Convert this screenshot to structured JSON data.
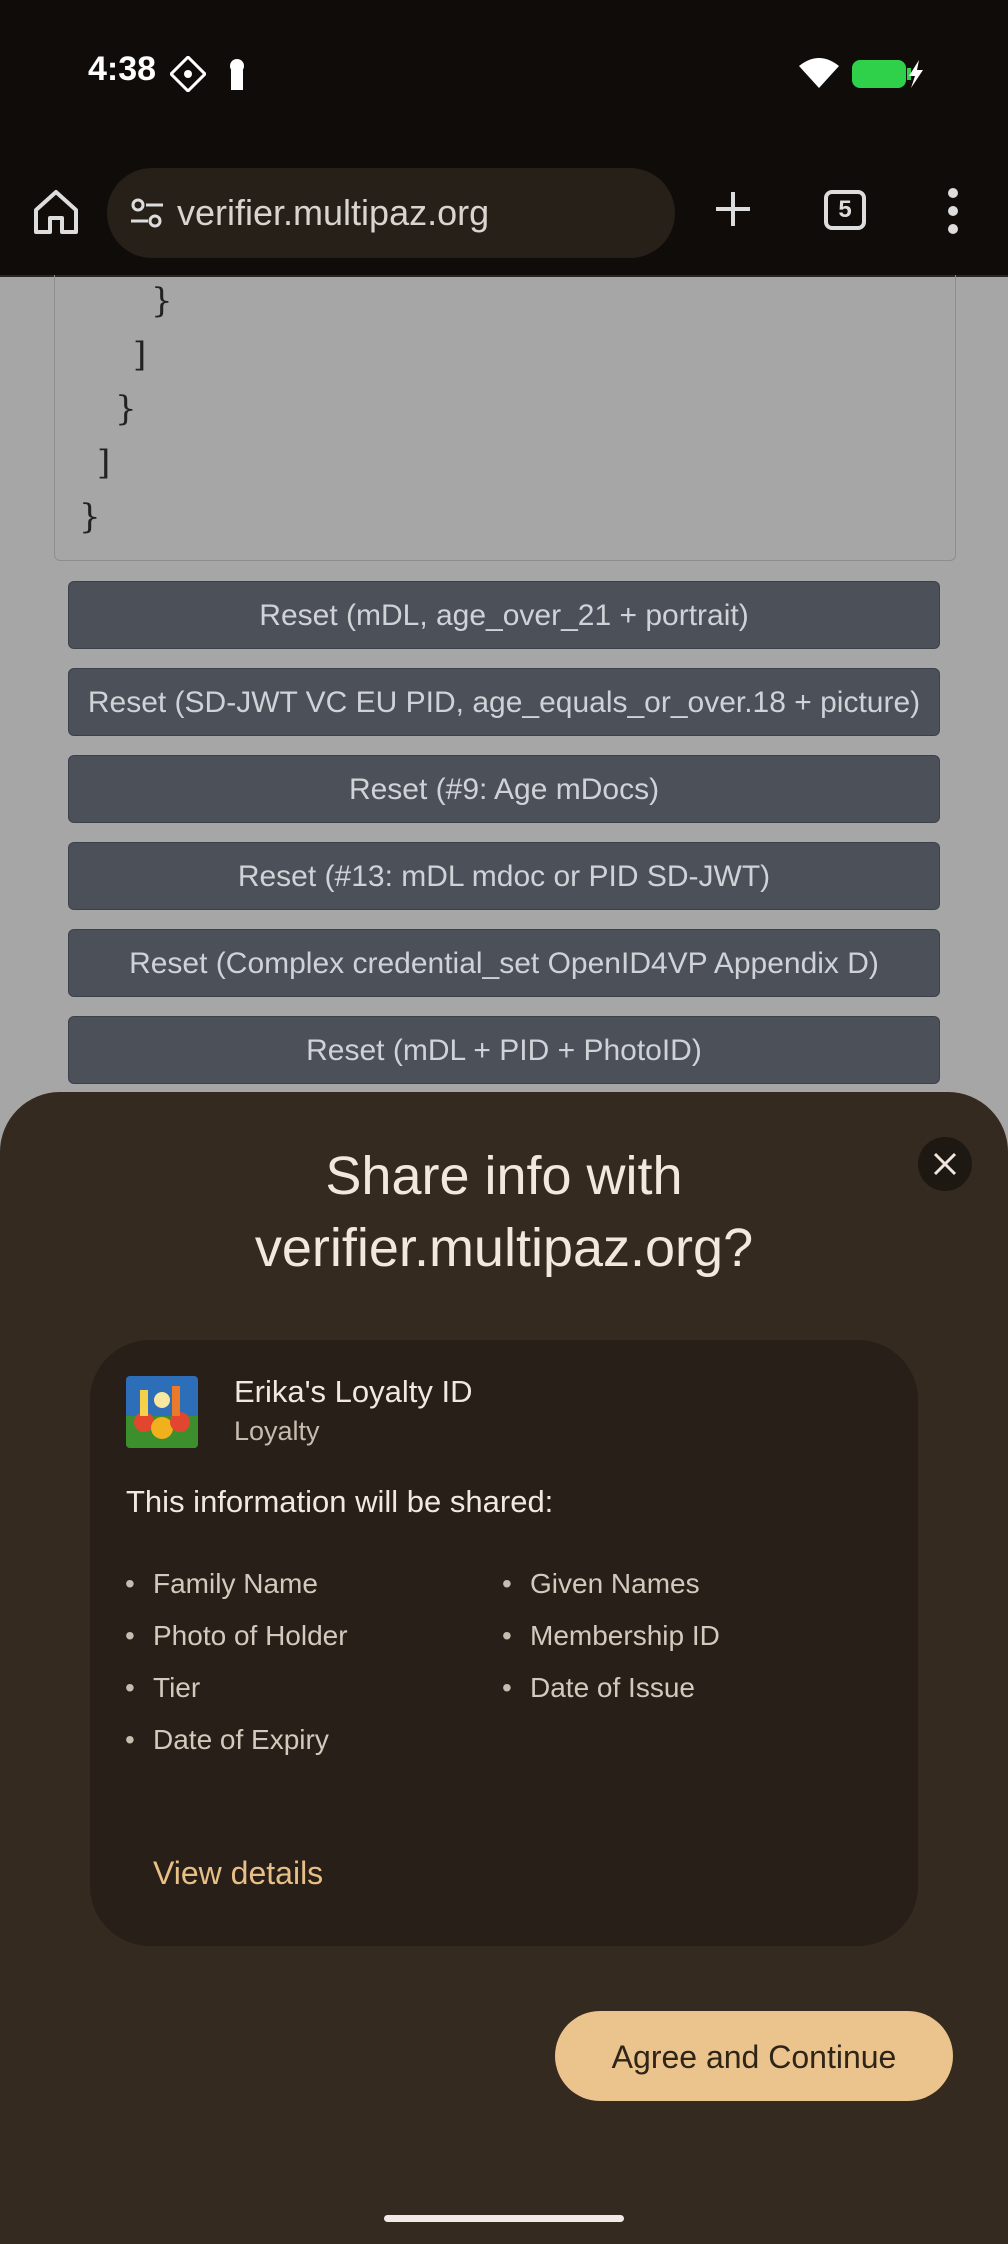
{
  "status_bar": {
    "time": "4:38"
  },
  "browser": {
    "url": "verifier.multipaz.org",
    "tab_count": "5"
  },
  "json_code": {
    "lines": [
      "}",
      "]",
      "}",
      "]",
      "}"
    ]
  },
  "reset_buttons": [
    "Reset (mDL, age_over_21 + portrait)",
    "Reset (SD-JWT VC EU PID, age_equals_or_over.18 + picture)",
    "Reset (#9: Age mDocs)",
    "Reset (#13: mDL mdoc or PID SD-JWT)",
    "Reset (Complex credential_set OpenID4VP Appendix D)",
    "Reset (mDL + PID + PhotoID)"
  ],
  "sheet": {
    "title_line1": "Share info with",
    "title_line2": "verifier.multipaz.org?",
    "credential": {
      "name": "Erika's Loyalty ID",
      "type": "Loyalty"
    },
    "shared_heading": "This information will be shared:",
    "attributes": [
      "Family Name",
      "Given Names",
      "Photo of Holder",
      "Membership ID",
      "Tier",
      "Date of Issue",
      "Date of Expiry"
    ],
    "view_details": "View details",
    "agree_button": "Agree and Continue"
  },
  "colors": {
    "sheet_bg": "#342a20",
    "card_bg": "#271f18",
    "accent": "#ebc38d",
    "reset_button_bg": "#4c5058"
  }
}
